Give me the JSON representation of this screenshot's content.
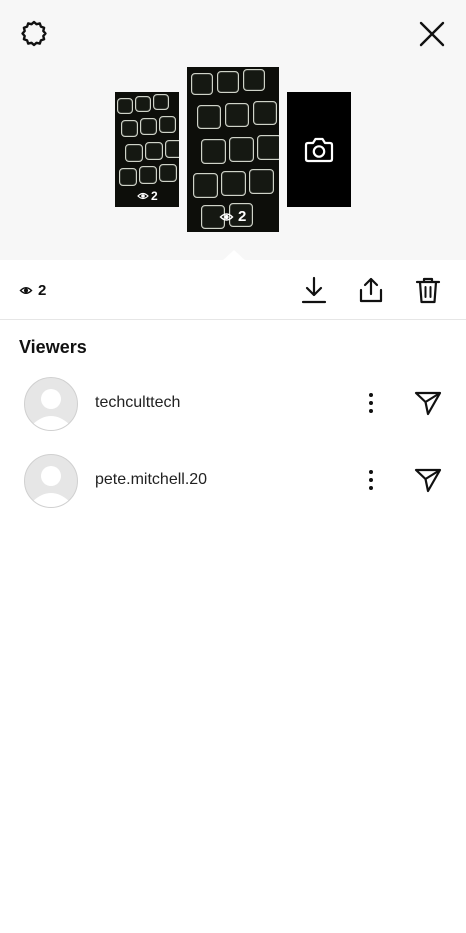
{
  "header": {
    "settings_icon": "gear-icon",
    "close_icon": "close-icon"
  },
  "story_thumbnails": [
    {
      "view_count": "2"
    },
    {
      "view_count": "2"
    },
    {
      "label_icon": "camera-icon"
    }
  ],
  "stats": {
    "view_count": "2",
    "actions": [
      "download-icon",
      "share-icon",
      "trash-icon"
    ]
  },
  "viewers": {
    "title": "Viewers",
    "items": [
      {
        "username": "techculttech"
      },
      {
        "username": "pete.mitchell.20"
      }
    ]
  }
}
